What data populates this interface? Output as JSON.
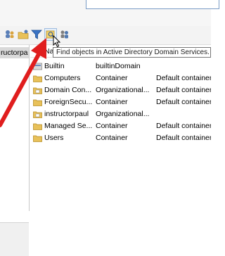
{
  "colors": {
    "accent_arrow": "#e01e1e",
    "folder_yellow": "#e8c15a",
    "tooltip_border": "#767676"
  },
  "toolbar": {
    "buttons": [
      {
        "icon": "add-user-to-group-icon"
      },
      {
        "icon": "new-folder-icon"
      },
      {
        "icon": "filter-icon"
      },
      {
        "icon": "find-objects-icon"
      },
      {
        "icon": "users-icon"
      }
    ]
  },
  "tree": {
    "selected_node": "ructorpa"
  },
  "list": {
    "rows": [
      {
        "name": "Builtin",
        "type": "builtinDomain",
        "description": "",
        "icon": "builtin-icon"
      },
      {
        "name": "Computers",
        "type": "Container",
        "description": "Default container",
        "icon": "folder-icon"
      },
      {
        "name": "Domain Con...",
        "type": "Organizational...",
        "description": "Default container",
        "icon": "ou-folder-icon"
      },
      {
        "name": "ForeignSecu...",
        "type": "Container",
        "description": "Default container",
        "icon": "folder-icon"
      },
      {
        "name": "instructorpaul",
        "type": "Organizational...",
        "description": "",
        "icon": "ou-folder-icon"
      },
      {
        "name": "Managed Se...",
        "type": "Container",
        "description": "Default container",
        "icon": "folder-icon"
      },
      {
        "name": "Users",
        "type": "Container",
        "description": "Default container",
        "icon": "folder-icon"
      }
    ]
  },
  "header": {
    "name_col_partial": "Na"
  },
  "tooltip": {
    "text": "Find objects in Active Directory Domain Services."
  }
}
